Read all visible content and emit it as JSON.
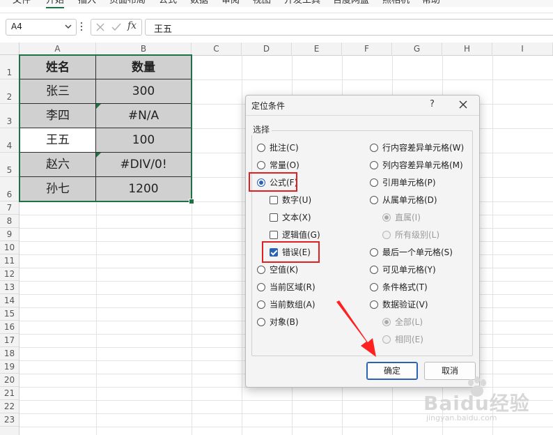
{
  "menu": [
    "文件",
    "开始",
    "插入",
    "页面布局",
    "公式",
    "数据",
    "审阅",
    "视图",
    "开发工具",
    "百度网盘",
    "照相机",
    "帮助"
  ],
  "formula_bar": {
    "name_box": "A4",
    "fx_label": "fx",
    "content": "王五"
  },
  "columns": [
    "A",
    "B",
    "C",
    "D",
    "E",
    "F",
    "G",
    "H",
    "I"
  ],
  "rows": [
    "1",
    "2",
    "3",
    "4",
    "5",
    "6",
    "7",
    "8",
    "9",
    "10",
    "11",
    "12",
    "13",
    "14",
    "15",
    "16",
    "17",
    "18",
    "19",
    "20",
    "21",
    "22",
    "23"
  ],
  "table": {
    "header": [
      "姓名",
      "数量"
    ],
    "rows": [
      [
        "张三",
        "300"
      ],
      [
        "李四",
        "#N/A"
      ],
      [
        "王五",
        "100"
      ],
      [
        "赵六",
        "#DIV/0!"
      ],
      [
        "孙七",
        "1200"
      ]
    ]
  },
  "dialog": {
    "title": "定位条件",
    "help": "?",
    "group_label": "选择",
    "left_options": [
      {
        "label": "批注(C)",
        "checked": false
      },
      {
        "label": "常量(O)",
        "checked": false
      },
      {
        "label": "公式(F)",
        "checked": true
      },
      {
        "label": "数字(U)",
        "checked": false
      },
      {
        "label": "文本(X)",
        "checked": false
      },
      {
        "label": "逻辑值(G)",
        "checked": false
      },
      {
        "label": "错误(E)",
        "checked": true
      },
      {
        "label": "空值(K)",
        "checked": false
      },
      {
        "label": "当前区域(R)",
        "checked": false
      },
      {
        "label": "当前数组(A)",
        "checked": false
      },
      {
        "label": "对象(B)",
        "checked": false
      }
    ],
    "right_options": [
      {
        "label": "行内容差异单元格(W)",
        "checked": false,
        "disabled": false
      },
      {
        "label": "列内容差异单元格(M)",
        "checked": false,
        "disabled": false
      },
      {
        "label": "引用单元格(P)",
        "checked": false,
        "disabled": false
      },
      {
        "label": "从属单元格(D)",
        "checked": false,
        "disabled": false
      },
      {
        "label": "直属(I)",
        "checked": true,
        "disabled": true
      },
      {
        "label": "所有级别(L)",
        "checked": false,
        "disabled": true
      },
      {
        "label": "最后一个单元格(S)",
        "checked": false,
        "disabled": false
      },
      {
        "label": "可见单元格(Y)",
        "checked": false,
        "disabled": false
      },
      {
        "label": "条件格式(T)",
        "checked": false,
        "disabled": false
      },
      {
        "label": "数据验证(V)",
        "checked": false,
        "disabled": false
      },
      {
        "label": "全部(L)",
        "checked": true,
        "disabled": true
      },
      {
        "label": "相同(E)",
        "checked": false,
        "disabled": true
      }
    ],
    "ok_label": "确定",
    "cancel_label": "取消"
  },
  "watermark": {
    "brand": "Baidu经验",
    "url": "jingyan.baidu.com"
  },
  "colors": {
    "accent_green": "#1e7145",
    "highlight_red": "#e02020",
    "arrow_red": "#ff2020",
    "dialog_blue": "#2b63b3"
  }
}
